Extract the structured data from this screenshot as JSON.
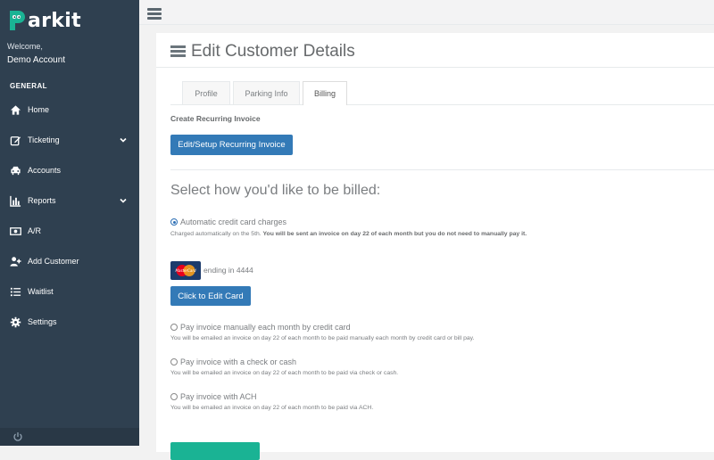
{
  "app": {
    "logo_text": "arkit"
  },
  "sidebar": {
    "welcome": "Welcome,",
    "account_name": "Demo Account",
    "section": "GENERAL",
    "items": [
      {
        "label": "Home",
        "icon": "home-icon"
      },
      {
        "label": "Ticketing",
        "icon": "edit-icon",
        "has_submenu": true
      },
      {
        "label": "Accounts",
        "icon": "car-icon"
      },
      {
        "label": "Reports",
        "icon": "bar-chart-icon",
        "has_submenu": true
      },
      {
        "label": "A/R",
        "icon": "money-icon"
      },
      {
        "label": "Add Customer",
        "icon": "user-plus-icon"
      },
      {
        "label": "Waitlist",
        "icon": "list-icon"
      },
      {
        "label": "Settings",
        "icon": "gear-icon"
      }
    ]
  },
  "page": {
    "title": "Edit Customer Details"
  },
  "tabs": [
    {
      "label": "Profile",
      "active": false
    },
    {
      "label": "Parking Info",
      "active": false
    },
    {
      "label": "Billing",
      "active": true
    }
  ],
  "recurring": {
    "label": "Create Recurring Invoice",
    "button": "Edit/Setup Recurring Invoice"
  },
  "billing": {
    "heading": "Select how you'd like to be billed:",
    "options": [
      {
        "label": "Automatic credit card charges",
        "checked": true,
        "desc_prefix": "Charged automatically on the 5th. ",
        "desc_bold": "You will be sent an invoice on day 22 of each month but you do not need to manually pay it."
      },
      {
        "label": "Pay invoice manually each month by credit card",
        "checked": false,
        "desc": "You will be emailed an invoice on day 22 of each month to be paid manually each month by credit card or bill pay."
      },
      {
        "label": "Pay invoice with a check or cash",
        "checked": false,
        "desc": "You will be emailed an invoice on day 22 of each month to be paid via check or cash."
      },
      {
        "label": "Pay invoice with ACH",
        "checked": false,
        "desc": "You will be emailed an invoice on day 22 of each month to be paid via ACH."
      }
    ],
    "card": {
      "brand": "MasterCard",
      "ending": "ending in 4444",
      "edit_button": "Click to Edit Card"
    }
  },
  "colors": {
    "sidebar": "#2f4050",
    "primary": "#337ab7",
    "success": "#1ab394",
    "logo_accent": "#1ab394"
  }
}
